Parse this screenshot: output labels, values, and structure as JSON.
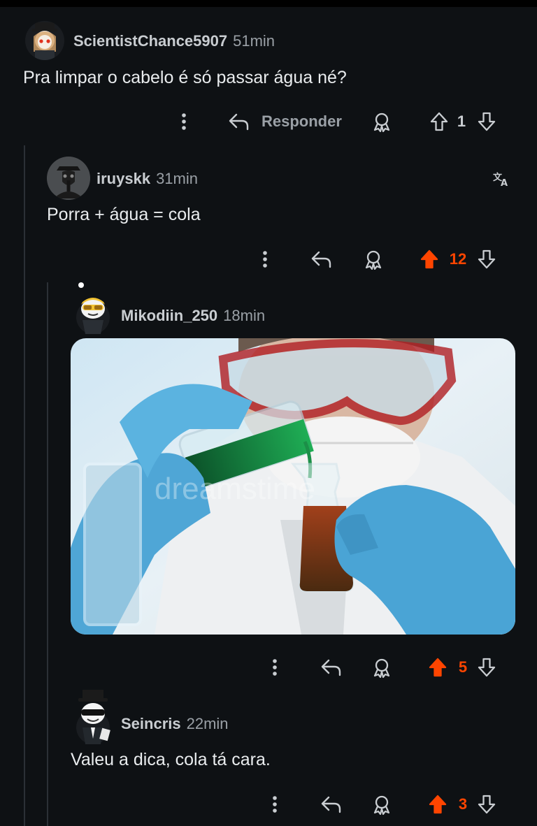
{
  "comments": [
    {
      "username": "ScientistChance5907",
      "time": "51min",
      "text": "Pra limpar o cabelo é só passar água né?",
      "reply_label": "Responder",
      "score": "1"
    },
    {
      "username": "iruyskk",
      "time": "31min",
      "text": "Porra + água = cola",
      "score": "12",
      "translate_icon": "translate-icon"
    },
    {
      "username": "Mikodiin_250",
      "time": "18min",
      "image": "scientist-pouring-green-liquid-into-beaker-photo",
      "score": "5"
    },
    {
      "username": "Seincris",
      "time": "22min",
      "text": "Valeu a dica, cola tá cara.",
      "score": "3"
    }
  ],
  "colors": {
    "background": "#0e1114",
    "upvote_active": "#ff4500",
    "muted": "#9aa0a6"
  }
}
